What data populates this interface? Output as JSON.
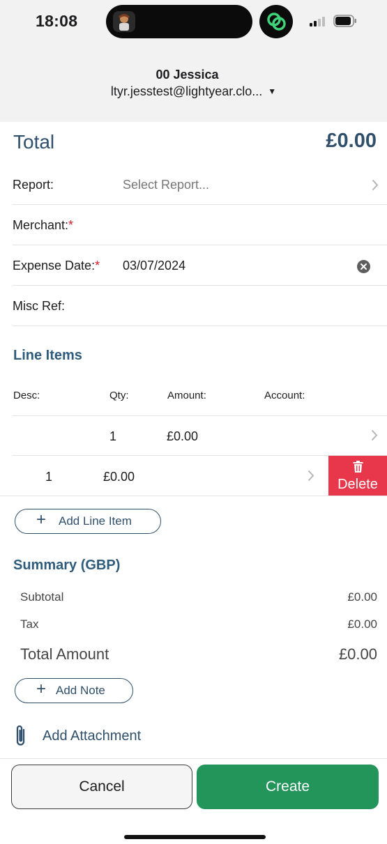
{
  "status_bar": {
    "time": "18:08"
  },
  "account": {
    "name": "00 Jessica",
    "email": "ltyr.jesstest@lightyear.clo..."
  },
  "total": {
    "label": "Total",
    "value": "£0.00"
  },
  "fields": {
    "report": {
      "label": "Report:",
      "placeholder": "Select Report..."
    },
    "merchant": {
      "label": "Merchant:",
      "required_mark": "*"
    },
    "expense_date": {
      "label": "Expense Date:",
      "required_mark": "*",
      "value": "03/07/2024"
    },
    "misc_ref": {
      "label": "Misc Ref:"
    }
  },
  "line_items": {
    "title": "Line Items",
    "columns": [
      "Desc:",
      "Qty:",
      "Amount:",
      "Account:"
    ],
    "rows": [
      {
        "qty": "1",
        "amount": "£0.00"
      },
      {
        "qty": "1",
        "amount": "£0.00",
        "swipe_action": "Delete"
      }
    ],
    "add_label": "Add Line Item"
  },
  "summary": {
    "title": "Summary (GBP)",
    "subtotal_label": "Subtotal",
    "subtotal_value": "£0.00",
    "tax_label": "Tax",
    "tax_value": "£0.00",
    "total_label": "Total Amount",
    "total_value": "£0.00"
  },
  "add_note_label": "Add Note",
  "add_attachment_label": "Add Attachment",
  "actions": {
    "cancel": "Cancel",
    "create": "Create"
  },
  "colors": {
    "primary": "#2f4f6a",
    "create": "#23955b",
    "delete": "#e8374a",
    "required": "#d6202c"
  },
  "icons": [
    "app-logo-icon",
    "chevron-down-icon",
    "chevron-right-icon",
    "clear-icon",
    "trash-icon",
    "plus-icon",
    "paperclip-icon"
  ]
}
